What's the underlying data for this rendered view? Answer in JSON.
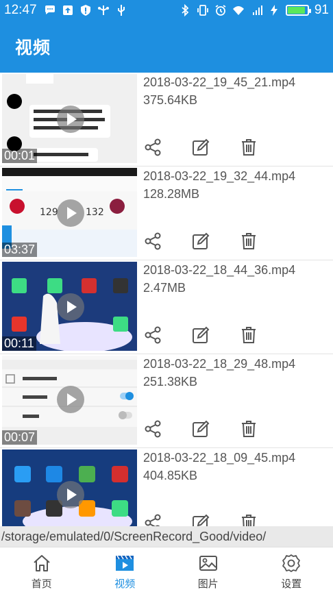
{
  "status_bar": {
    "time": "12:47",
    "battery_percent": "91",
    "battery_level": 0.91,
    "left_icons": [
      "chat-icon",
      "upload-icon",
      "shield-icon",
      "usb-fork-icon",
      "usb-icon"
    ],
    "right_icons": [
      "bluetooth-icon",
      "vibrate-icon",
      "alarm-icon",
      "wifi-icon",
      "signal-4g-icon",
      "charging-icon"
    ]
  },
  "app_bar": {
    "title": "视频"
  },
  "videos": [
    {
      "name": "2018-03-22_19_45_21.mp4",
      "size": "375.64KB",
      "duration": "00:01"
    },
    {
      "name": "2018-03-22_19_32_44.mp4",
      "size": "128.28MB",
      "duration": "03:37"
    },
    {
      "name": "2018-03-22_18_44_36.mp4",
      "size": "2.47MB",
      "duration": "00:11"
    },
    {
      "name": "2018-03-22_18_29_48.mp4",
      "size": "251.38KB",
      "duration": "00:07"
    },
    {
      "name": "2018-03-22_18_09_45.mp4",
      "size": "404.85KB",
      "duration": ""
    }
  ],
  "actions": {
    "share_icon": "share-icon",
    "edit_icon": "edit-icon",
    "delete_icon": "trash-icon"
  },
  "path_bar": {
    "path": "/storage/emulated/0/ScreenRecord_Good/video/"
  },
  "bottom_nav": {
    "items": [
      {
        "label": "首页",
        "icon": "home-icon"
      },
      {
        "label": "视频",
        "icon": "video-icon"
      },
      {
        "label": "图片",
        "icon": "image-icon"
      },
      {
        "label": "设置",
        "icon": "settings-icon"
      }
    ],
    "active_index": 1
  },
  "colors": {
    "primary": "#1e8fe0",
    "text": "#555555",
    "icon": "#555555"
  }
}
